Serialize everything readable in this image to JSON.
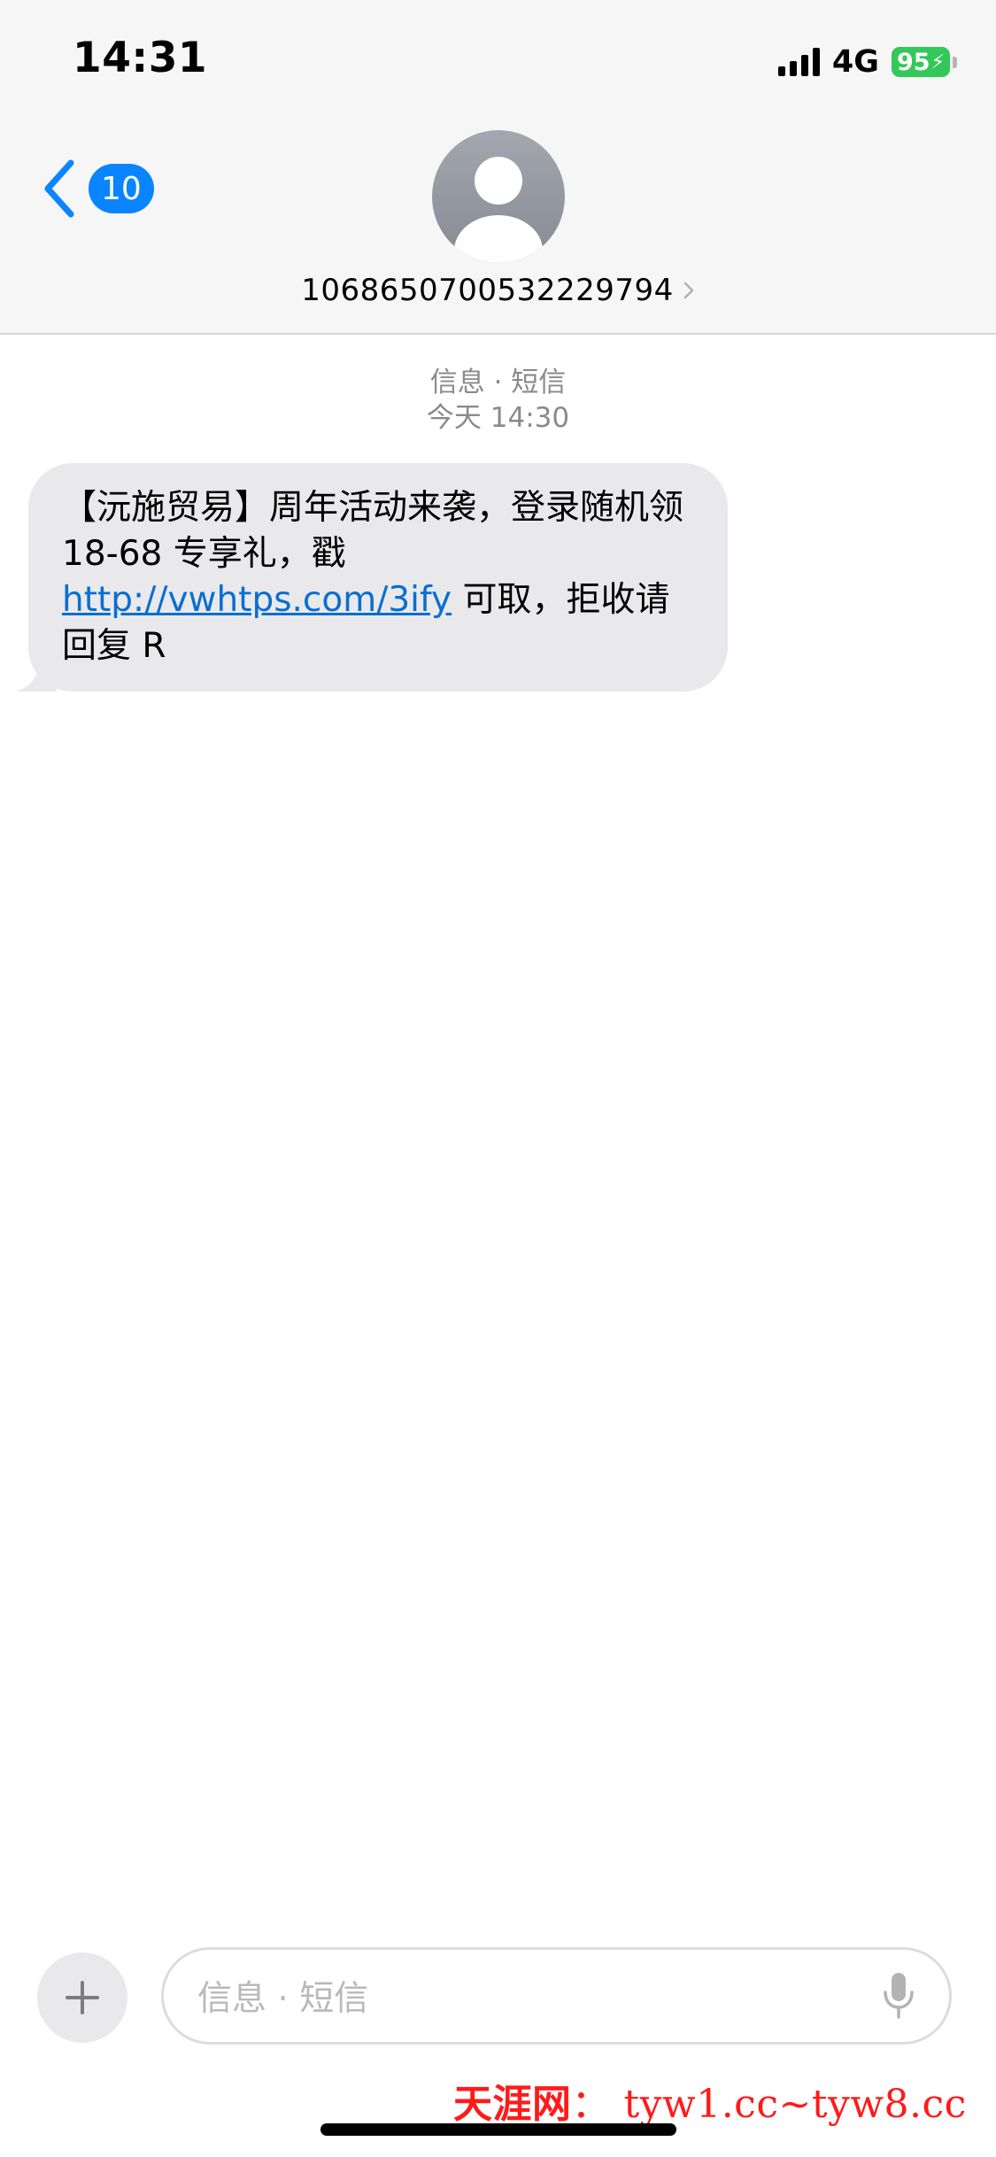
{
  "status_bar": {
    "time": "14:31",
    "network": "4G",
    "battery": "95"
  },
  "nav": {
    "back_badge": "10",
    "contact_number": "1068650700532229794"
  },
  "conversation": {
    "service": "信息 · 短信",
    "timestamp": "今天 14:30",
    "message": {
      "text_before_link": "【沅施贸易】周年活动来袭，登录随机领 18-68 专享礼，戳 ",
      "link": "http://vwhtps.com/3ify",
      "text_after_link": " 可取，拒收请回复 R"
    }
  },
  "composer": {
    "placeholder": "信息 · 短信"
  },
  "watermark": {
    "name": "天涯网",
    "separator": "：",
    "urls": "tyw1.cc~tyw8.cc"
  },
  "colors": {
    "accent": "#0a84ff",
    "battery": "#34c759",
    "bubble": "#e9e9eb",
    "link": "#0a6ed1",
    "watermark": "#ff1a1a"
  },
  "icons": {
    "back": "chevron-left-icon",
    "avatar": "person-icon",
    "plus": "plus-icon",
    "mic": "microphone-icon"
  }
}
